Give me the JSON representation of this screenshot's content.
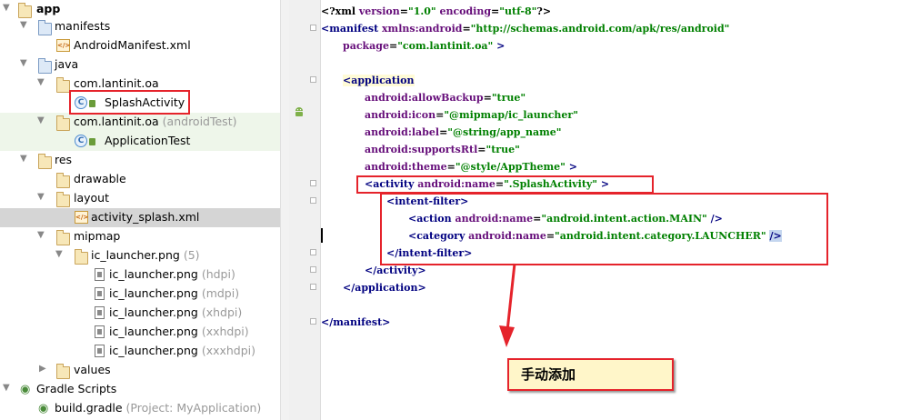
{
  "tree": {
    "items": [
      {
        "label": "app",
        "sub": ""
      },
      {
        "label": "manifests",
        "sub": ""
      },
      {
        "label": "AndroidManifest.xml",
        "sub": ""
      },
      {
        "label": "java",
        "sub": ""
      },
      {
        "label": "com.lantinit.oa",
        "sub": ""
      },
      {
        "label": "SplashActivity",
        "sub": ""
      },
      {
        "label": "com.lantinit.oa",
        "sub": "(androidTest)"
      },
      {
        "label": "ApplicationTest",
        "sub": ""
      },
      {
        "label": "res",
        "sub": ""
      },
      {
        "label": "drawable",
        "sub": ""
      },
      {
        "label": "layout",
        "sub": ""
      },
      {
        "label": "activity_splash.xml",
        "sub": ""
      },
      {
        "label": "mipmap",
        "sub": ""
      },
      {
        "label": "ic_launcher.png",
        "sub": "(5)"
      },
      {
        "label": "ic_launcher.png",
        "sub": "(hdpi)"
      },
      {
        "label": "ic_launcher.png",
        "sub": "(mdpi)"
      },
      {
        "label": "ic_launcher.png",
        "sub": "(xhdpi)"
      },
      {
        "label": "ic_launcher.png",
        "sub": "(xxhdpi)"
      },
      {
        "label": "ic_launcher.png",
        "sub": "(xxxhdpi)"
      },
      {
        "label": "values",
        "sub": ""
      },
      {
        "label": "Gradle Scripts",
        "sub": ""
      },
      {
        "label": "build.gradle",
        "sub": "(Project: MyApplication)"
      }
    ]
  },
  "code": {
    "l1": {
      "a": "<?xml ",
      "b": "version",
      "c": "=",
      "d": "\"1.0\"",
      "e": " ",
      "f": "encoding",
      "g": "=",
      "h": "\"utf-8\"",
      "i": "?>"
    },
    "l2": {
      "a": "<manifest ",
      "b": "xmlns:android",
      "c": "=",
      "d": "\"http://schemas.android.com/apk/res/android\""
    },
    "l3": {
      "a": "package",
      "b": "=",
      "c": "\"com.lantinit.oa\"",
      "d": " >"
    },
    "l5": {
      "a": "<application"
    },
    "l6": {
      "a": "android:allowBackup",
      "b": "=",
      "c": "\"true\""
    },
    "l7": {
      "a": "android:icon",
      "b": "=",
      "c": "\"@mipmap/ic_launcher\""
    },
    "l8": {
      "a": "android:label",
      "b": "=",
      "c": "\"@string/app_name\""
    },
    "l9": {
      "a": "android:supportsRtl",
      "b": "=",
      "c": "\"true\""
    },
    "l10": {
      "a": "android:theme",
      "b": "=",
      "c": "\"@style/AppTheme\"",
      "d": " >"
    },
    "l11": {
      "a": "<activity ",
      "b": "android:name",
      "c": "=",
      "d": "\".SplashActivity\"",
      "e": " >"
    },
    "l12": {
      "a": "<intent-filter",
      "b": ">"
    },
    "l13": {
      "a": "<action ",
      "b": "android:name",
      "c": "=",
      "d": "\"android.intent.action.MAIN\"",
      "e": " />"
    },
    "l14": {
      "a": "<category ",
      "b": "android:name",
      "c": "=",
      "d": "\"android.intent.category.LAUNCHER\"",
      "e": " ",
      "f": "/>"
    },
    "l15": {
      "a": "</intent-filter>"
    },
    "l16": {
      "a": "</activity>"
    },
    "l17": {
      "a": "</application>"
    },
    "l19": {
      "a": "</manifest>"
    }
  },
  "annotation": {
    "note": "手动添加"
  },
  "colors": {
    "annotation_red": "#e5232b",
    "note_bg": "#fff6c9",
    "tag": "#000080",
    "attr": "#660e7a",
    "value": "#008000",
    "selected_row": "#d5d5d5"
  }
}
